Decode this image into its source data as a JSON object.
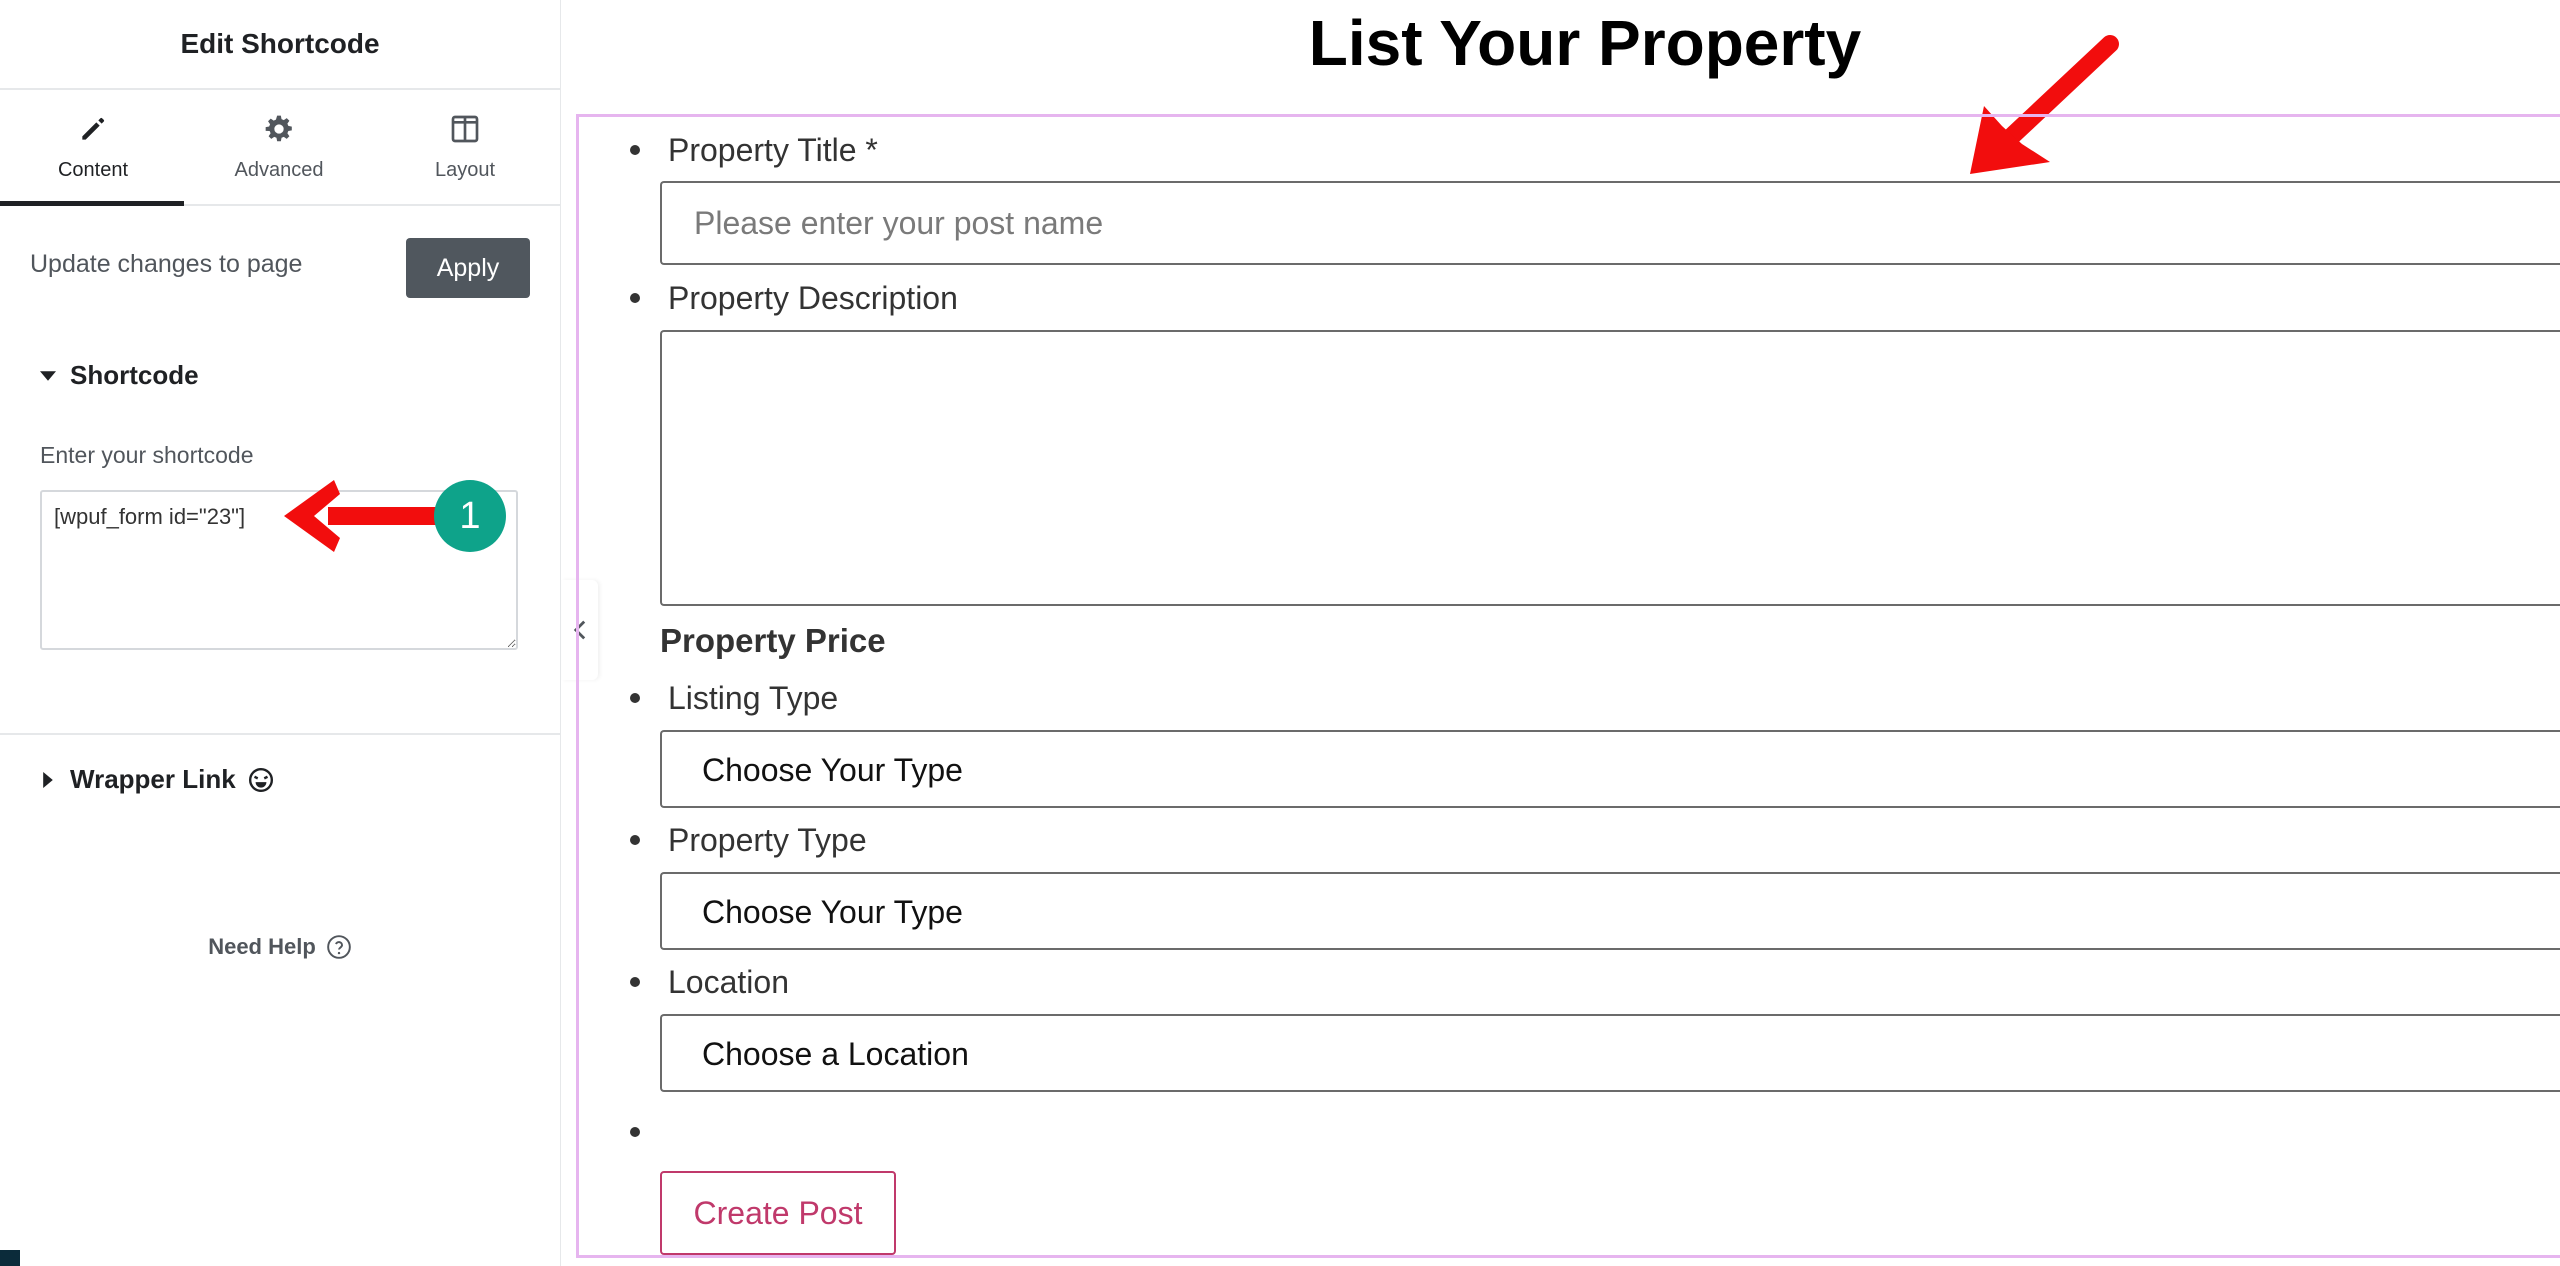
{
  "panel": {
    "title": "Edit Shortcode",
    "tabs": [
      {
        "label": "Content",
        "icon": "pencil-icon"
      },
      {
        "label": "Advanced",
        "icon": "gear-icon"
      },
      {
        "label": "Layout",
        "icon": "layout-icon"
      }
    ],
    "update_label": "Update changes to page",
    "apply_label": "Apply",
    "shortcode_section": "Shortcode",
    "shortcode_label": "Enter your shortcode",
    "shortcode_value": "[wpuf_form id=\"23\"]",
    "wrapper_section": "Wrapper Link",
    "help_label": "Need Help"
  },
  "annotations": {
    "badge_number": "1",
    "arrow_color": "#f20d0d",
    "badge_color": "#0ea38a"
  },
  "preview": {
    "heading": "List Your Property",
    "fields": [
      {
        "label": "Property Title *",
        "placeholder": "Please enter your post name"
      },
      {
        "label": "Property Description"
      },
      {
        "label": "Listing Type",
        "selected": "Choose Your Type"
      },
      {
        "label": "Property Type",
        "selected": "Choose Your Type"
      },
      {
        "label": "Location",
        "selected": "Choose a Location"
      }
    ],
    "price_heading": "Property Price",
    "submit_label": "Create Post"
  }
}
